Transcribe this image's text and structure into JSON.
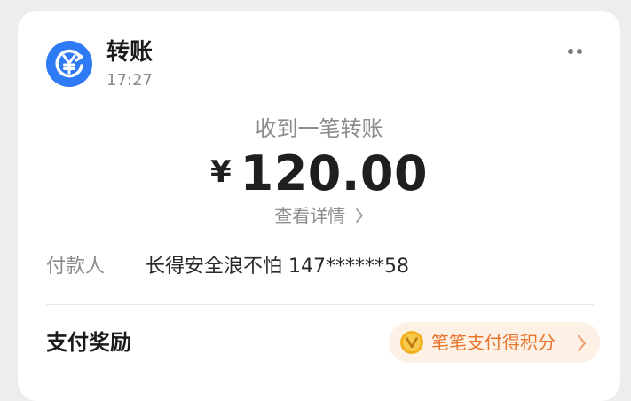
{
  "notification": {
    "app_icon": "yuan-circular-arrow-icon",
    "app_title": "转账",
    "time": "17:27",
    "more_icon": "more-dots-icon"
  },
  "transfer": {
    "subtitle": "收到一笔转账",
    "currency_symbol": "¥",
    "amount": "120.00",
    "details_link": "查看详情"
  },
  "payer": {
    "label": "付款人",
    "value": "长得安全浪不怕 147******58"
  },
  "reward": {
    "title": "支付奖励",
    "pill_icon": "v-badge-icon",
    "pill_label": "笔笔支付得积分",
    "pill_chevron": "chevron-right-icon"
  },
  "colors": {
    "brand_blue": "#2f7af5",
    "reward_orange": "#e8752d",
    "reward_bg": "#fdf0e4",
    "badge_gold": "#f2b01e"
  }
}
